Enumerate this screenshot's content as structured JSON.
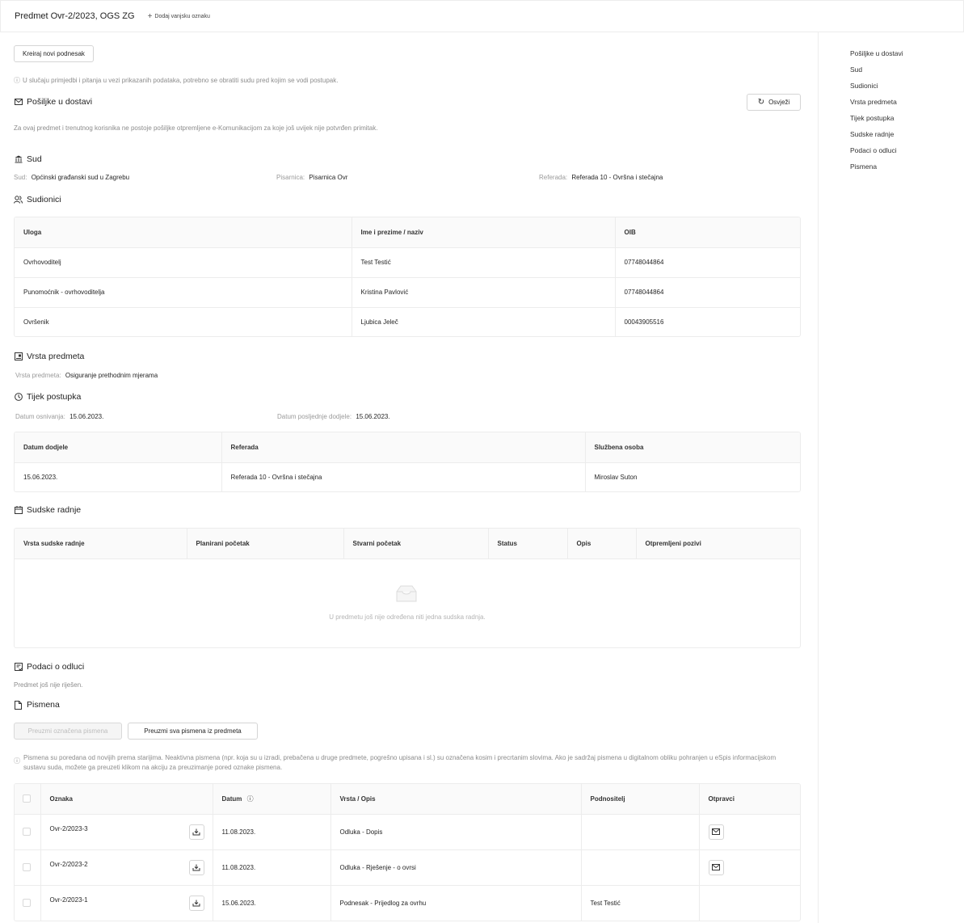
{
  "header": {
    "title": "Predmet  Ovr-2/2023, OGS ZG",
    "add_tag": "Dodaj vanjsku oznaku"
  },
  "actions": {
    "create_submission": "Kreiraj novi podnesak",
    "refresh": "Osvježi"
  },
  "notice": "U slučaju primjedbi i pitanja u vezi prikazanih podataka, potrebno se obratiti sudu pred kojim se vodi postupak.",
  "sections": {
    "deliveries": {
      "title": "Pošiljke u dostavi",
      "text": "Za ovaj predmet i trenutnog korisnika ne postoje pošiljke otpremljene e-Komunikacijom za koje još uvijek nije potvrđen primitak."
    },
    "court": {
      "title": "Sud",
      "fields": [
        {
          "label": "Sud",
          "value": "Općinski građanski sud u Zagrebu"
        },
        {
          "label": "Pisarnica",
          "value": "Pisarnica Ovr"
        },
        {
          "label": "Referada",
          "value": "Referada 10 - Ovršna i stečajna"
        }
      ]
    },
    "participants": {
      "title": "Sudionici",
      "columns": [
        "Uloga",
        "Ime i prezime / naziv",
        "OIB"
      ],
      "rows": [
        [
          "Ovrhovoditelj",
          "Test Testić",
          "07748044864"
        ],
        [
          "Punomoćnik - ovrhovoditelja",
          "Kristina Pavlović",
          "07748044864"
        ],
        [
          "Ovršenik",
          "Ljubica Jeleč",
          "00043905516"
        ]
      ]
    },
    "case_type": {
      "title": "Vrsta predmeta",
      "label": "Vrsta predmeta",
      "value": "Osiguranje prethodnim mjerama"
    },
    "proceedings": {
      "title": "Tijek postupka",
      "fields": [
        {
          "label": "Datum osnivanja",
          "value": "15.06.2023."
        },
        {
          "label": "Datum posljednje dodjele",
          "value": "15.06.2023."
        }
      ],
      "columns": [
        "Datum dodjele",
        "Referada",
        "Službena osoba"
      ],
      "rows": [
        [
          "15.06.2023.",
          "Referada 10 - Ovršna i stečajna",
          "Miroslav Suton"
        ]
      ]
    },
    "court_actions": {
      "title": "Sudske radnje",
      "columns": [
        "Vrsta sudske radnje",
        "Planirani početak",
        "Stvarni početak",
        "Status",
        "Opis",
        "Otpremljeni pozivi"
      ],
      "empty": "U predmetu još nije određena niti jedna sudska radnja."
    },
    "decision": {
      "title": "Podaci o odluci",
      "text": "Predmet još nije riješen."
    },
    "documents": {
      "title": "Pismena",
      "download_selected": "Preuzmi označena pismena",
      "download_all": "Preuzmi sva pismena iz predmeta",
      "info": "Pismena su poredana od novijih prema starijima. Neaktivna pismena (npr. koja su u izradi, prebačena u druge predmete, pogrešno upisana i sl.) su označena kosim i precrtanim slovima. Ako je sadržaj pismena u digitalnom obliku pohranjen u eSpis informacijskom sustavu suda, možete ga preuzeti klikom na akciju za preuzimanje pored oznake pismena.",
      "columns": [
        "Oznaka",
        "Datum",
        "Vrsta / Opis",
        "Podnositelj",
        "Otpravci"
      ],
      "rows": [
        {
          "mark": "Ovr-2/2023-3",
          "date": "11.08.2023.",
          "type": "Odluka - Dopis",
          "submitter": "",
          "has_dispatch": true
        },
        {
          "mark": "Ovr-2/2023-2",
          "date": "11.08.2023.",
          "type": "Odluka - Rješenje - o ovrsi",
          "submitter": "",
          "has_dispatch": true
        },
        {
          "mark": "Ovr-2/2023-1",
          "date": "15.06.2023.",
          "type": "Podnesak - Prijedlog za ovrhu",
          "submitter": "Test Testić",
          "has_dispatch": false
        }
      ]
    }
  },
  "sidebar": {
    "items": [
      "Pošiljke u dostavi",
      "Sud",
      "Sudionici",
      "Vrsta predmeta",
      "Tijek postupka",
      "Sudske radnje",
      "Podaci o odluci",
      "Pismena"
    ]
  }
}
